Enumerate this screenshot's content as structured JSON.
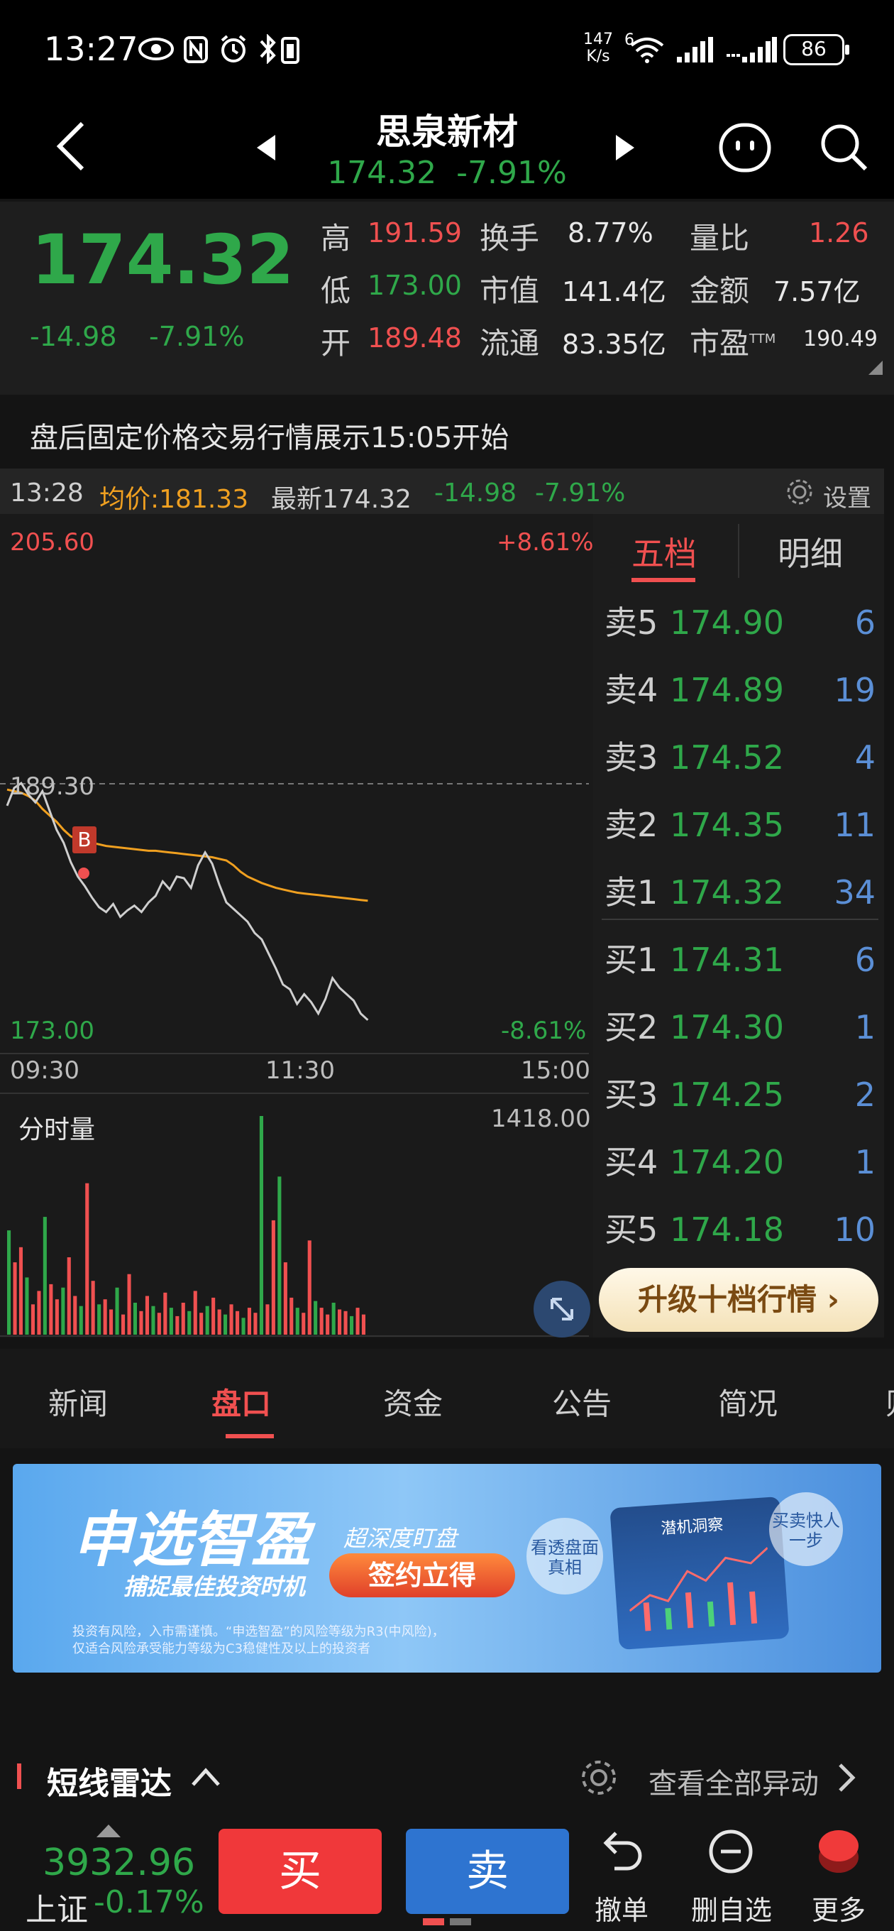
{
  "status_bar": {
    "time": "13:27",
    "net_speed": "147",
    "net_unit": "K/s",
    "net_type": "6",
    "battery": "86",
    "icons": [
      "eye-icon",
      "nfc-icon",
      "alarm-icon",
      "bluetooth-battery-icon",
      "wifi-icon",
      "signal-icon",
      "signal-icon-2"
    ]
  },
  "header": {
    "stock_name": "思泉新材",
    "price": "174.32",
    "pct": "-7.91%",
    "icons": [
      "back-icon",
      "prev-stock-icon",
      "next-stock-icon",
      "robot-icon",
      "search-icon"
    ]
  },
  "quote": {
    "last": "174.32",
    "change": "-14.98",
    "change_pct": "-7.91%",
    "high_label": "高",
    "high": "191.59",
    "low_label": "低",
    "low": "173.00",
    "open_label": "开",
    "open": "189.48",
    "turnover_label": "换手",
    "turnover": "8.77%",
    "mktcap_label": "市值",
    "mktcap": "141.4亿",
    "float_label": "流通",
    "float": "83.35亿",
    "volratio_label": "量比",
    "volratio": "1.26",
    "amount_label": "金额",
    "amount": "7.57亿",
    "pe_label": "市盈",
    "pe_sup": "TTM",
    "pe": "190.49"
  },
  "notice": "盘后固定价格交易行情展示15:05开始",
  "info_line": {
    "time": "13:28",
    "avg_label": "均价:181.33",
    "latest": "最新174.32",
    "change": "-14.98",
    "pct": "-7.91%",
    "settings": "设置"
  },
  "chart": {
    "top_price": "205.60",
    "top_pct": "+8.61%",
    "mid_price": "189.30",
    "bottom_price": "173.00",
    "bottom_pct": "-8.61%",
    "time_start": "09:30",
    "time_mid": "11:30",
    "time_end": "15:00",
    "volume_label": "分时量",
    "volume_max": "1418.00",
    "marker": "B",
    "colors": {
      "price_line": "#cfcfcf",
      "avg_line": "#f0a020",
      "up": "#f05050",
      "down": "#2fa84a"
    }
  },
  "chart_data": {
    "type": "line",
    "title": "",
    "ylim": [
      173.0,
      205.6
    ],
    "x_range": [
      "09:30",
      "15:00"
    ],
    "series": [
      {
        "name": "",
        "values": [
          187.5,
          188.6,
          188.9,
          188.2,
          187.7,
          188.4,
          187.2,
          186.0,
          185.2,
          184.0,
          183.1,
          182.5,
          181.8,
          181.2,
          180.9,
          181.4,
          180.6,
          181.0,
          181.3,
          180.9,
          181.5,
          181.9,
          182.8,
          182.3,
          183.1,
          183.0,
          182.4,
          183.8,
          184.6,
          183.9,
          182.6,
          181.5,
          181.1,
          180.7,
          180.3,
          179.6,
          179.2,
          178.3,
          177.4,
          176.4,
          176.1,
          175.2,
          175.8,
          175.3,
          174.6,
          175.5,
          176.8,
          176.2,
          175.8,
          175.4,
          174.6,
          174.2
        ]
      },
      {
        "name": "",
        "values": [
          188.5,
          188.4,
          188.3,
          188.1,
          187.8,
          187.3,
          186.9,
          186.5,
          186.0,
          185.6,
          185.4,
          185.3,
          185.2,
          185.1,
          185.0,
          184.95,
          184.9,
          184.85,
          184.8,
          184.75,
          184.7,
          184.7,
          184.65,
          184.6,
          184.55,
          184.5,
          184.45,
          184.4,
          184.35,
          184.3,
          184.2,
          184.1,
          183.8,
          183.4,
          183.1,
          182.9,
          182.7,
          182.55,
          182.4,
          182.3,
          182.2,
          182.1,
          182.05,
          182.0,
          181.95,
          181.9,
          181.85,
          181.8,
          181.75,
          181.7,
          181.65,
          181.6
        ]
      }
    ],
    "volume_max": 1418.0,
    "volume": [
      620,
      430,
      520,
      340,
      180,
      260,
      700,
      300,
      210,
      280,
      460,
      230,
      170,
      900,
      320,
      180,
      210,
      150,
      280,
      120,
      360,
      190,
      140,
      230,
      170,
      130,
      250,
      160,
      110,
      190,
      140,
      260,
      130,
      170,
      220,
      150,
      120,
      180,
      140,
      100,
      160,
      130,
      1300,
      180,
      680,
      940,
      430,
      220,
      160,
      130,
      560,
      200,
      160,
      120,
      190,
      150,
      140,
      110,
      160,
      120
    ]
  },
  "order_book": {
    "tab_active": "五档",
    "tab_other": "明细",
    "rows": [
      {
        "label": "卖5",
        "price": "174.90",
        "vol": "6"
      },
      {
        "label": "卖4",
        "price": "174.89",
        "vol": "19"
      },
      {
        "label": "卖3",
        "price": "174.52",
        "vol": "4"
      },
      {
        "label": "卖2",
        "price": "174.35",
        "vol": "11"
      },
      {
        "label": "卖1",
        "price": "174.32",
        "vol": "34"
      },
      {
        "label": "买1",
        "price": "174.31",
        "vol": "6"
      },
      {
        "label": "买2",
        "price": "174.30",
        "vol": "1"
      },
      {
        "label": "买3",
        "price": "174.25",
        "vol": "2"
      },
      {
        "label": "买4",
        "price": "174.20",
        "vol": "1"
      },
      {
        "label": "买5",
        "price": "174.18",
        "vol": "10"
      }
    ],
    "upgrade": "升级十档行情 ›"
  },
  "tabs": [
    "新闻",
    "盘口",
    "资金",
    "公告",
    "简况",
    "则"
  ],
  "banner": {
    "brand": "申选智盈",
    "slogan": "捕捉最佳投资时机",
    "tag": "超深度盯盘",
    "cta": "签约立得",
    "bubble1": "看透盘面真相",
    "bubble2": "买卖快人一步",
    "screen_title": "潜机洞察",
    "disclaimer1": "投资有风险，入市需谨慎。“申选智盈”的风险等级为R3(中风险)，",
    "disclaimer2": "仅适合风险承受能力等级为C3稳健性及以上的投资者"
  },
  "radar": {
    "title": "短线雷达",
    "view_all": "查看全部异动"
  },
  "bottom": {
    "index_value": "3932.96",
    "index_name": "上证",
    "index_pct": "-0.17%",
    "buy": "买",
    "sell": "卖",
    "cancel": "撤单",
    "remove": "删自选",
    "more": "更多"
  }
}
